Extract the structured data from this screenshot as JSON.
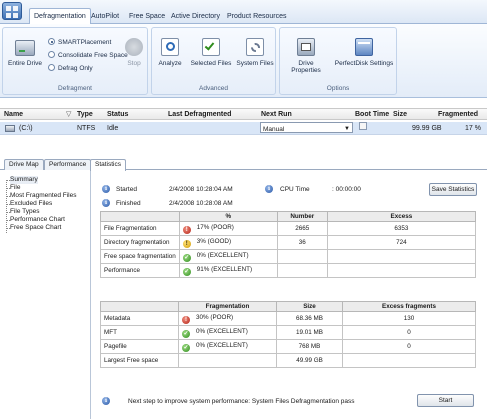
{
  "menu": {
    "tabs": [
      "Defragmentation",
      "AutoPilot",
      "Free Space",
      "Active Directory",
      "Product Resources"
    ]
  },
  "ribbon": {
    "defragment": {
      "label": "Defragment",
      "entire_drive": "Entire Drive",
      "options": [
        "SMARTPlacement",
        "Consolidate Free Space",
        "Defrag Only"
      ],
      "stop": "Stop"
    },
    "advanced": {
      "label": "Advanced",
      "analyze": "Analyze",
      "selected_files": "Selected Files",
      "system_files": "System Files"
    },
    "options": {
      "label": "Options",
      "drive_properties": "Drive Properties",
      "perfectdisk_settings": "PerfectDisk Settings"
    }
  },
  "drive_list": {
    "headers": [
      "Name",
      "Type",
      "Status",
      "Last Defragmented",
      "Next Run",
      "Boot Time",
      "Size",
      "Fragmented"
    ],
    "row": {
      "name": "(C:\\)",
      "type": "NTFS",
      "status": "Idle",
      "last_defragmented": "",
      "next_run": "Manual",
      "size": "99.99 GB",
      "fragmented": "17 %"
    }
  },
  "view_tabs": [
    "Drive Map",
    "Performance",
    "Statistics"
  ],
  "tree": [
    "Summary",
    "File",
    "Most Fragmented Files",
    "Excluded Files",
    "File Types",
    "Performance Chart",
    "Free Space Chart"
  ],
  "summary": {
    "started_label": "Started",
    "started_value": "2/4/2008 10:28:04 AM",
    "finished_label": "Finished",
    "finished_value": "2/4/2008 10:28:08 AM",
    "cpu_label": "CPU Time",
    "cpu_value": ": 00:00:00",
    "save_button": "Save Statistics"
  },
  "table1": {
    "headers": [
      "",
      "%",
      "Number",
      "Excess"
    ],
    "rows": [
      {
        "label": "File Fragmentation",
        "status": "poor",
        "pct": "17% (POOR)",
        "number": "2665",
        "excess": "6353"
      },
      {
        "label": "Directory fragmentation",
        "status": "good",
        "pct": "3% (GOOD)",
        "number": "36",
        "excess": "724"
      },
      {
        "label": "Free space fragmentation",
        "status": "excellent",
        "pct": "0% (EXCELLENT)",
        "number": "",
        "excess": ""
      },
      {
        "label": "Performance",
        "status": "excellent",
        "pct": "91% (EXCELLENT)",
        "number": "",
        "excess": ""
      }
    ]
  },
  "table2": {
    "headers": [
      "",
      "Fragmentation",
      "Size",
      "Excess fragments"
    ],
    "rows": [
      {
        "label": "Metadata",
        "status": "poor",
        "frag": "30% (POOR)",
        "size": "68.36 MB",
        "excess": "130"
      },
      {
        "label": "MFT",
        "status": "excellent",
        "frag": "0% (EXCELLENT)",
        "size": "19.01 MB",
        "excess": "0"
      },
      {
        "label": "Pagefile",
        "status": "excellent",
        "frag": "0% (EXCELLENT)",
        "size": "768 MB",
        "excess": "0"
      },
      {
        "label": "Largest Free space",
        "status": "",
        "frag": "",
        "size": "49.99 GB",
        "excess": ""
      }
    ]
  },
  "next_step": {
    "text": "Next step to improve system performance: System Files Defragmentation pass",
    "button": "Start"
  },
  "colors": {
    "poor": "#b3261b",
    "good": "#d19b00",
    "excellent": "#2f8c1d",
    "selection": "#d9e6f7"
  }
}
